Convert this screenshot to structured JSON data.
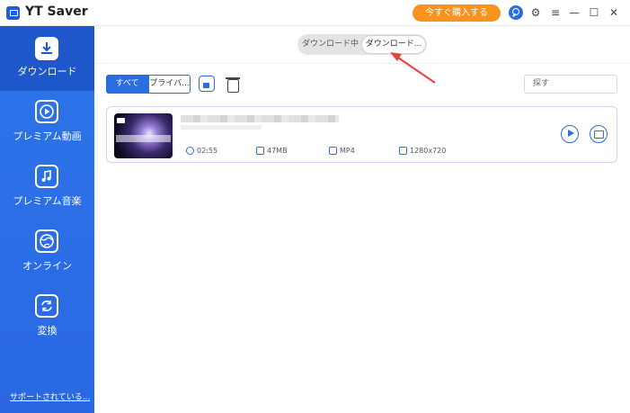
{
  "app": {
    "title": "YT Saver",
    "buy_label": "今すぐ購入する"
  },
  "titlebar_icons": [
    "key-icon",
    "gear-icon",
    "menu-icon",
    "minimize-icon",
    "maximize-icon",
    "close-icon"
  ],
  "sidebar": {
    "items": [
      {
        "label": "ダウンロード",
        "icon": "download-icon",
        "active": true
      },
      {
        "label": "プレミアム動画",
        "icon": "play-icon",
        "active": false
      },
      {
        "label": "プレミアム音楽",
        "icon": "music-icon",
        "active": false
      },
      {
        "label": "オンライン",
        "icon": "globe-icon",
        "active": false
      },
      {
        "label": "変換",
        "icon": "convert-icon",
        "active": false
      }
    ],
    "support_link": "サポートされている..."
  },
  "tabs": {
    "downloading": "ダウンロード中",
    "downloaded": "ダウンロード..."
  },
  "filters": {
    "all": "すべて",
    "private": "プライバ..."
  },
  "search": {
    "placeholder": "探す"
  },
  "downloads": [
    {
      "duration": "02:55",
      "size": "47MB",
      "format": "MP4",
      "resolution": "1280x720"
    }
  ],
  "colors": {
    "accent": "#2a6de0",
    "sidebar": "#2d74ea",
    "buy_button": "#f7931e",
    "annotation": "#e8423a"
  }
}
